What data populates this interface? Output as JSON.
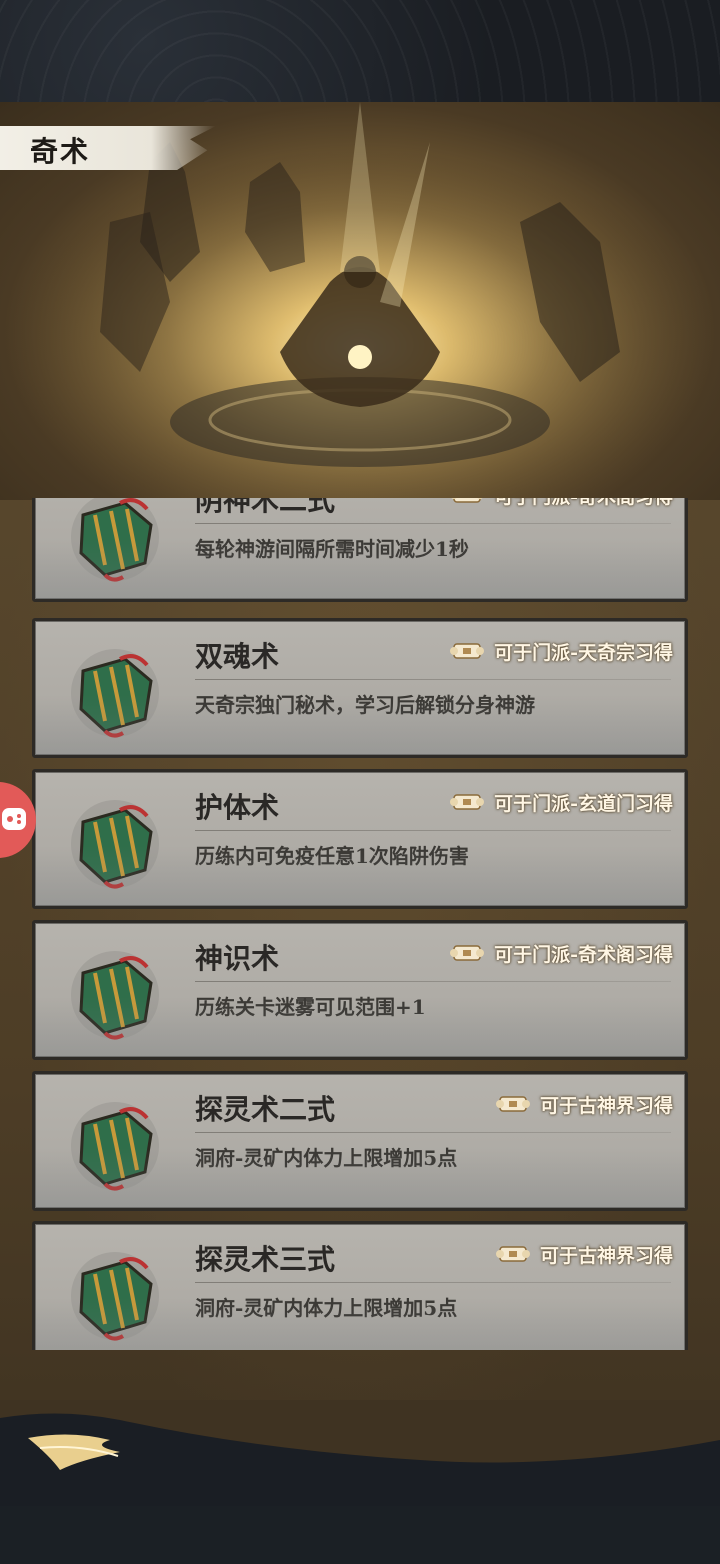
{
  "page": {
    "title": "奇术"
  },
  "items": [
    {
      "name": "阴神术二式",
      "source": "可于门派-奇术阁习得",
      "desc": "每轮神游间隔所需时间减少1秒"
    },
    {
      "name": "双魂术",
      "source": "可于门派-天奇宗习得",
      "desc": "天奇宗独门秘术，学习后解锁分身神游"
    },
    {
      "name": "护体术",
      "source": "可于门派-玄道门习得",
      "desc": "历练内可免疫任意1次陷阱伤害"
    },
    {
      "name": "神识术",
      "source": "可于门派-奇术阁习得",
      "desc": "历练关卡迷雾可见范围+1"
    },
    {
      "name": "探灵术二式",
      "source": "可于古神界习得",
      "desc": "洞府-灵矿内体力上限增加5点"
    },
    {
      "name": "探灵术三式",
      "source": "可于古神界习得",
      "desc": "洞府-灵矿内体力上限增加5点"
    }
  ],
  "icons": {
    "book": "scripture-book-icon",
    "source": "scroll-icon",
    "floating": "gamepad-icon"
  },
  "colors": {
    "card": "#b0ada7",
    "panel": "#57462c",
    "float_button": "#e25a58"
  }
}
